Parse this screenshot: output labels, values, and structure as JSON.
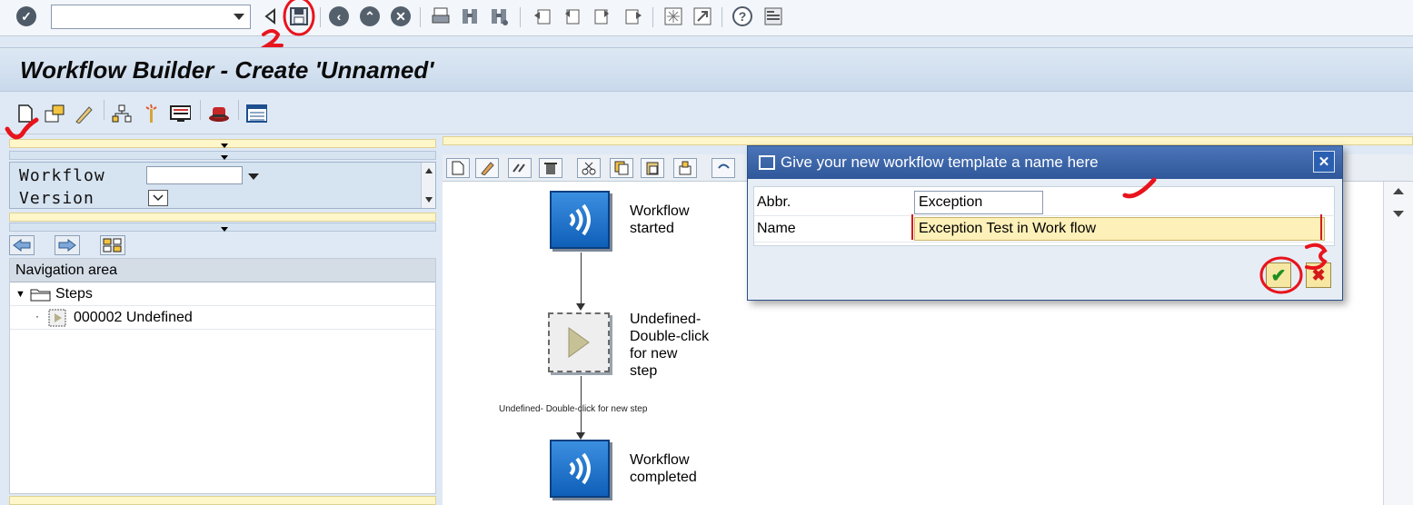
{
  "window": {
    "title": "Workflow Builder - Create 'Unnamed'"
  },
  "system_toolbar": {
    "command_field_value": "",
    "buttons": [
      "enter-icon",
      "back-nav-icon",
      "save-icon",
      "back-icon",
      "exit-icon",
      "cancel-icon",
      "print-icon",
      "find-icon",
      "find-next-icon",
      "first-page-icon",
      "previous-page-icon",
      "next-page-icon",
      "last-page-icon",
      "create-session-icon",
      "shortcut-icon",
      "help-icon",
      "layout-menu-icon"
    ]
  },
  "app_toolbar": {
    "buttons": [
      "new-icon",
      "open-icon",
      "edit-icon",
      "structure-icon",
      "wand-icon",
      "display-icon",
      "test-icon",
      "list-icon"
    ]
  },
  "left_panel": {
    "workflow_label": "Workflow",
    "workflow_value": "",
    "version_label": "Version",
    "nav_area_title": "Navigation area",
    "tree": [
      {
        "label": "Steps",
        "icon": "folder-icon",
        "expanded": true
      },
      {
        "label": "000002 Undefined",
        "icon": "step-icon"
      }
    ]
  },
  "canvas": {
    "nodes": [
      {
        "label_lines": [
          "Workflow",
          "started"
        ],
        "icon": "event-icon"
      },
      {
        "label_lines": [
          "Undefined-",
          "Double-click",
          "for new",
          "step"
        ],
        "icon": "undefined-step-icon"
      },
      {
        "label_lines": [
          "Workflow",
          "completed"
        ],
        "icon": "event-icon"
      }
    ],
    "connector_label": "Undefined- Double-click for new step"
  },
  "dialog": {
    "title": "Give your new workflow template a name here",
    "fields": [
      {
        "label": "Abbr.",
        "value": "Exception"
      },
      {
        "label": "Name",
        "value": "Exception Test in Work flow"
      }
    ],
    "ok_label": "✔",
    "cancel_label": "✖"
  },
  "colors": {
    "title_bar": "#c9d9eb",
    "dialog_title": "#2f5799",
    "required_field": "#fdf0b8",
    "annotation": "#e8141d"
  }
}
